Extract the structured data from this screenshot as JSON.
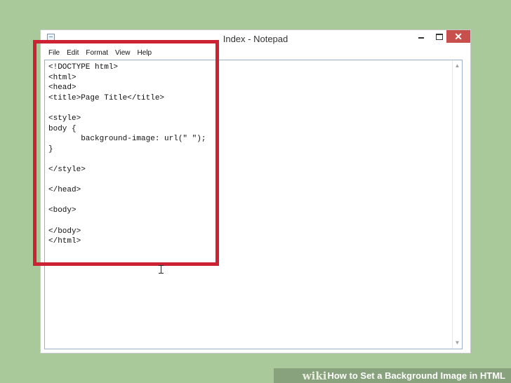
{
  "window": {
    "title": "Index - Notepad",
    "close_glyph": "✕"
  },
  "menu": [
    "File",
    "Edit",
    "Format",
    "View",
    "Help"
  ],
  "editor": {
    "content": "<!DOCTYPE html>\n<html>\n<head>\n<title>Page Title</title>\n\n<style>\nbody {\n       background-image: url(\" \");\n}\n\n</style>\n\n</head>\n\n<body>\n\n</body>\n</html>"
  },
  "watermark": {
    "logo": "wiki",
    "title": "How to Set a Background Image in HTML"
  },
  "colors": {
    "highlight": "#cc2233",
    "close_button": "#c7504c",
    "background": "#a9c99b"
  },
  "icons": {
    "app": "notepad-icon",
    "scroll_up": "scroll-up-arrow-icon",
    "scroll_down": "scroll-down-arrow-icon",
    "cursor": "ibeam-cursor-icon"
  }
}
